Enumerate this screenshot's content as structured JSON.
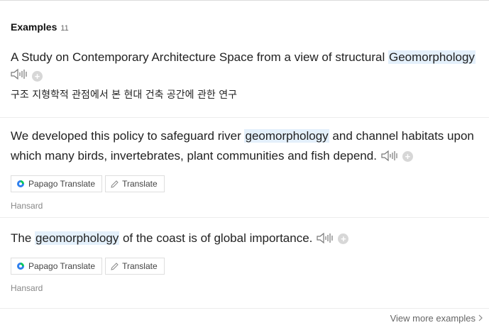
{
  "header": {
    "title": "Examples",
    "count": "11"
  },
  "examples": [
    {
      "pre": "A Study on Contemporary Architecture Space from a view of structural ",
      "term": "Geomorphology",
      "post": "",
      "translation": "구조 지형학적 관점에서 본 현대 건축 공간에 관한 연구"
    },
    {
      "pre": "We developed this policy to safeguard river ",
      "term": "geomorphology",
      "post": " and channel habitats upon which many birds, invertebrates, plant communities and fish depend.",
      "papago_label": "Papago Translate",
      "translate_label": "Translate",
      "source": "Hansard"
    },
    {
      "pre": "The ",
      "term": "geomorphology",
      "post": " of the coast is of global importance.",
      "papago_label": "Papago Translate",
      "translate_label": "Translate",
      "source": "Hansard"
    }
  ],
  "footer": {
    "view_more": "View more examples"
  },
  "icons": {
    "speaker": "speaker-icon",
    "add": "add-icon",
    "papago": "papago-icon",
    "pencil": "pencil-icon",
    "chevron": "chevron-right-icon"
  },
  "colors": {
    "highlight": "#e4f0fb",
    "papago_green": "#03c75a",
    "papago_blue": "#2f80ed"
  }
}
